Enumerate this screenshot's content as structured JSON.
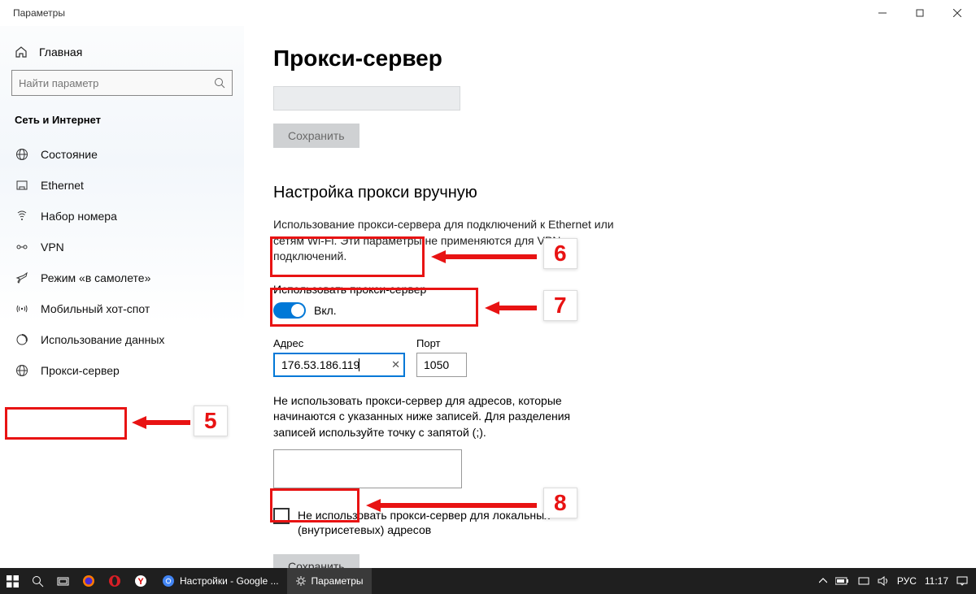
{
  "window": {
    "title": "Параметры"
  },
  "sidebar": {
    "home": "Главная",
    "search_placeholder": "Найти параметр",
    "section": "Сеть и Интернет",
    "items": [
      {
        "label": "Состояние"
      },
      {
        "label": "Ethernet"
      },
      {
        "label": "Набор номера"
      },
      {
        "label": "VPN"
      },
      {
        "label": "Режим «в самолете»"
      },
      {
        "label": "Мобильный хот-спот"
      },
      {
        "label": "Использование данных"
      },
      {
        "label": "Прокси-сервер"
      }
    ]
  },
  "main": {
    "title": "Прокси-сервер",
    "save_disabled": "Сохранить",
    "manual_heading": "Настройка прокси вручную",
    "manual_desc": "Использование прокси-сервера для подключений к Ethernet или сетям Wi-Fi. Эти параметры не применяются для VPN-подключений.",
    "use_proxy_label": "Использовать прокси-сервер",
    "toggle_state": "Вкл.",
    "address_label": "Адрес",
    "address_value": "176.53.186.119",
    "port_label": "Порт",
    "port_value": "1050",
    "exclude_desc": "Не использовать прокси-сервер для адресов, которые начинаются с указанных ниже записей. Для разделения записей используйте точку с запятой (;).",
    "local_checkbox": "Не использовать прокси-сервер для локальных (внутрисетевых) адресов",
    "save": "Сохранить"
  },
  "annotations": {
    "n5": "5",
    "n6": "6",
    "n7": "7",
    "n8": "8"
  },
  "taskbar": {
    "browser_tab": "Настройки - Google ...",
    "settings_tab": "Параметры",
    "lang": "РУС",
    "time": "11:17"
  }
}
